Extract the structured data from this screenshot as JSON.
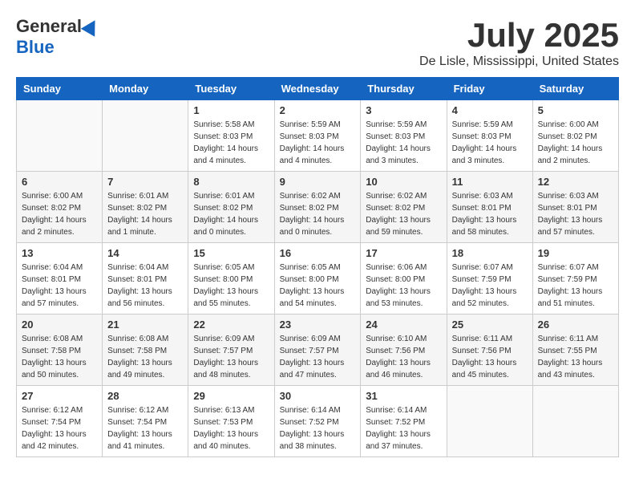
{
  "header": {
    "logo": {
      "general": "General",
      "blue": "Blue"
    },
    "title": "July 2025",
    "location": "De Lisle, Mississippi, United States"
  },
  "calendar": {
    "days_of_week": [
      "Sunday",
      "Monday",
      "Tuesday",
      "Wednesday",
      "Thursday",
      "Friday",
      "Saturday"
    ],
    "weeks": [
      [
        {
          "day": "",
          "info": ""
        },
        {
          "day": "",
          "info": ""
        },
        {
          "day": "1",
          "info": "Sunrise: 5:58 AM\nSunset: 8:03 PM\nDaylight: 14 hours\nand 4 minutes."
        },
        {
          "day": "2",
          "info": "Sunrise: 5:59 AM\nSunset: 8:03 PM\nDaylight: 14 hours\nand 4 minutes."
        },
        {
          "day": "3",
          "info": "Sunrise: 5:59 AM\nSunset: 8:03 PM\nDaylight: 14 hours\nand 3 minutes."
        },
        {
          "day": "4",
          "info": "Sunrise: 5:59 AM\nSunset: 8:03 PM\nDaylight: 14 hours\nand 3 minutes."
        },
        {
          "day": "5",
          "info": "Sunrise: 6:00 AM\nSunset: 8:02 PM\nDaylight: 14 hours\nand 2 minutes."
        }
      ],
      [
        {
          "day": "6",
          "info": "Sunrise: 6:00 AM\nSunset: 8:02 PM\nDaylight: 14 hours\nand 2 minutes."
        },
        {
          "day": "7",
          "info": "Sunrise: 6:01 AM\nSunset: 8:02 PM\nDaylight: 14 hours\nand 1 minute."
        },
        {
          "day": "8",
          "info": "Sunrise: 6:01 AM\nSunset: 8:02 PM\nDaylight: 14 hours\nand 0 minutes."
        },
        {
          "day": "9",
          "info": "Sunrise: 6:02 AM\nSunset: 8:02 PM\nDaylight: 14 hours\nand 0 minutes."
        },
        {
          "day": "10",
          "info": "Sunrise: 6:02 AM\nSunset: 8:02 PM\nDaylight: 13 hours\nand 59 minutes."
        },
        {
          "day": "11",
          "info": "Sunrise: 6:03 AM\nSunset: 8:01 PM\nDaylight: 13 hours\nand 58 minutes."
        },
        {
          "day": "12",
          "info": "Sunrise: 6:03 AM\nSunset: 8:01 PM\nDaylight: 13 hours\nand 57 minutes."
        }
      ],
      [
        {
          "day": "13",
          "info": "Sunrise: 6:04 AM\nSunset: 8:01 PM\nDaylight: 13 hours\nand 57 minutes."
        },
        {
          "day": "14",
          "info": "Sunrise: 6:04 AM\nSunset: 8:01 PM\nDaylight: 13 hours\nand 56 minutes."
        },
        {
          "day": "15",
          "info": "Sunrise: 6:05 AM\nSunset: 8:00 PM\nDaylight: 13 hours\nand 55 minutes."
        },
        {
          "day": "16",
          "info": "Sunrise: 6:05 AM\nSunset: 8:00 PM\nDaylight: 13 hours\nand 54 minutes."
        },
        {
          "day": "17",
          "info": "Sunrise: 6:06 AM\nSunset: 8:00 PM\nDaylight: 13 hours\nand 53 minutes."
        },
        {
          "day": "18",
          "info": "Sunrise: 6:07 AM\nSunset: 7:59 PM\nDaylight: 13 hours\nand 52 minutes."
        },
        {
          "day": "19",
          "info": "Sunrise: 6:07 AM\nSunset: 7:59 PM\nDaylight: 13 hours\nand 51 minutes."
        }
      ],
      [
        {
          "day": "20",
          "info": "Sunrise: 6:08 AM\nSunset: 7:58 PM\nDaylight: 13 hours\nand 50 minutes."
        },
        {
          "day": "21",
          "info": "Sunrise: 6:08 AM\nSunset: 7:58 PM\nDaylight: 13 hours\nand 49 minutes."
        },
        {
          "day": "22",
          "info": "Sunrise: 6:09 AM\nSunset: 7:57 PM\nDaylight: 13 hours\nand 48 minutes."
        },
        {
          "day": "23",
          "info": "Sunrise: 6:09 AM\nSunset: 7:57 PM\nDaylight: 13 hours\nand 47 minutes."
        },
        {
          "day": "24",
          "info": "Sunrise: 6:10 AM\nSunset: 7:56 PM\nDaylight: 13 hours\nand 46 minutes."
        },
        {
          "day": "25",
          "info": "Sunrise: 6:11 AM\nSunset: 7:56 PM\nDaylight: 13 hours\nand 45 minutes."
        },
        {
          "day": "26",
          "info": "Sunrise: 6:11 AM\nSunset: 7:55 PM\nDaylight: 13 hours\nand 43 minutes."
        }
      ],
      [
        {
          "day": "27",
          "info": "Sunrise: 6:12 AM\nSunset: 7:54 PM\nDaylight: 13 hours\nand 42 minutes."
        },
        {
          "day": "28",
          "info": "Sunrise: 6:12 AM\nSunset: 7:54 PM\nDaylight: 13 hours\nand 41 minutes."
        },
        {
          "day": "29",
          "info": "Sunrise: 6:13 AM\nSunset: 7:53 PM\nDaylight: 13 hours\nand 40 minutes."
        },
        {
          "day": "30",
          "info": "Sunrise: 6:14 AM\nSunset: 7:52 PM\nDaylight: 13 hours\nand 38 minutes."
        },
        {
          "day": "31",
          "info": "Sunrise: 6:14 AM\nSunset: 7:52 PM\nDaylight: 13 hours\nand 37 minutes."
        },
        {
          "day": "",
          "info": ""
        },
        {
          "day": "",
          "info": ""
        }
      ]
    ]
  }
}
